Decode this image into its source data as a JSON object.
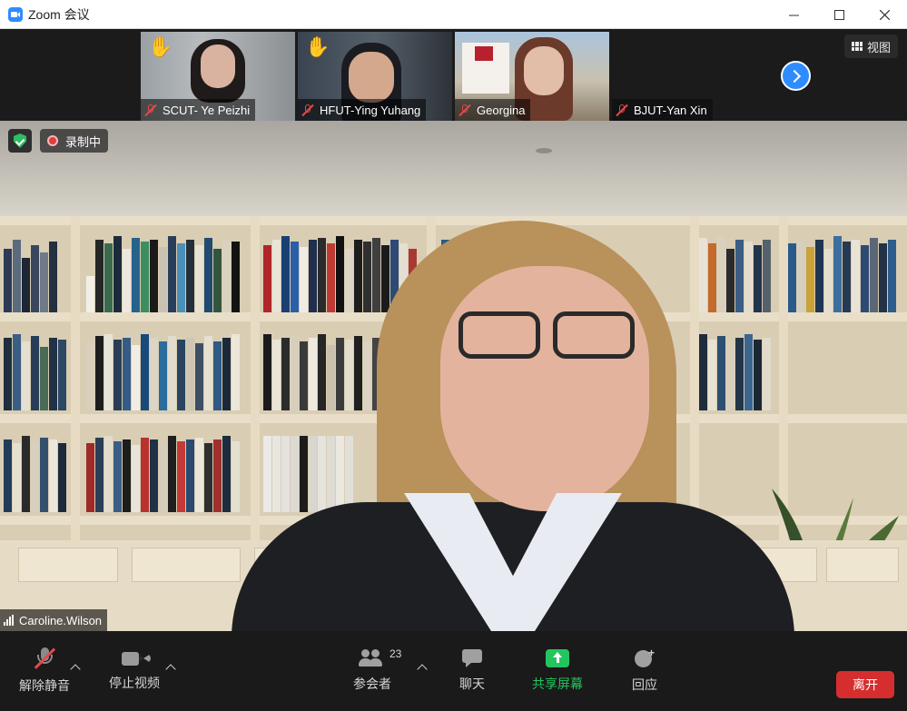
{
  "window": {
    "title": "Zoom 会议",
    "controls": [
      "minimize",
      "maximize",
      "close"
    ]
  },
  "thumbnails": [
    {
      "name": "SCUT- Ye Peizhi",
      "hand_raised": true,
      "muted": true
    },
    {
      "name": "HFUT-Ying Yuhang",
      "hand_raised": true,
      "muted": true
    },
    {
      "name": "Georgina",
      "hand_raised": false,
      "muted": true
    },
    {
      "name": "BJUT-Yan Xin",
      "hand_raised": false,
      "muted": true
    }
  ],
  "view_button": {
    "label": "视图"
  },
  "main": {
    "recording_label": "录制中",
    "speaker_name": "Caroline.Wilson"
  },
  "toolbar": {
    "unmute_label": "解除静音",
    "stop_video_label": "停止视频",
    "participants_label": "参会者",
    "participants_count": "23",
    "chat_label": "聊天",
    "share_label": "共享屏幕",
    "reactions_label": "回应",
    "leave_label": "离开"
  },
  "colors": {
    "accent_blue": "#2d8cff",
    "share_green": "#23c55e",
    "leave_red": "#d62e2e",
    "mute_red": "#e64848",
    "hand_yellow": "#f5c518"
  }
}
